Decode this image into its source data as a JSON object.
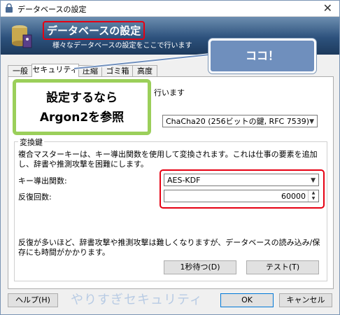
{
  "window": {
    "title": "データベースの設定",
    "close_glyph": "✕"
  },
  "banner": {
    "heading": "データベースの設定",
    "subtitle": "様々なデータベースの設定をここで行います"
  },
  "tabs": [
    {
      "label": "一般"
    },
    {
      "label": "セキュリティ"
    },
    {
      "label": "圧縮"
    },
    {
      "label": "ゴミ箱"
    },
    {
      "label": "高度"
    }
  ],
  "encryption": {
    "intro_text": "行います",
    "algorithm_value": "ChaCha20 (256ビットの鍵, RFC 7539)"
  },
  "key_transform": {
    "group_label": "変換鍵",
    "description": "複合マスターキーは、キー導出関数を使用して変換されます。これは仕事の要素を追加し、辞書や推測攻撃を困難にします。",
    "kdf_label": "キー導出関数:",
    "kdf_value": "AES-KDF",
    "rounds_label": "反復回数:",
    "rounds_value": "60000",
    "note": "反復が多いほど、辞書攻撃や推測攻撃は難しくなりますが、データベースの読み込み/保存にも時間がかかります。",
    "wait_button": "1秒待つ(D)",
    "test_button": "テスト(T)"
  },
  "footer": {
    "help_button": "ヘルプ(H)",
    "watermark": "やりすぎセキュリティ",
    "ok_button": "OK",
    "cancel_button": "キャンセル"
  },
  "callouts": {
    "here": "ココ！",
    "argon_line1": "設定するなら",
    "argon_line2": "Argon2を参照"
  },
  "colors": {
    "highlight_red": "#e60012",
    "callout_blue": "#6f8fbd",
    "callout_green": "#9bcf5a",
    "banner": "#2d527d"
  }
}
